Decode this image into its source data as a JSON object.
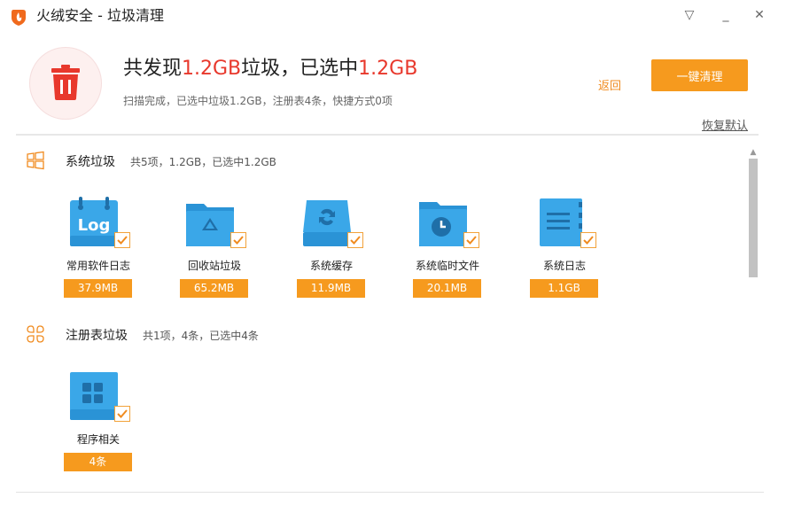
{
  "window": {
    "title": "火绒安全 - 垃圾清理",
    "controls": {
      "menu": "▽",
      "minimize": "_",
      "close": "✕"
    }
  },
  "summary": {
    "headline_pre": "共发现",
    "headline_size1": "1.2GB",
    "headline_mid": "垃圾，已选中",
    "headline_size2": "1.2GB",
    "subline": "扫描完成，已选中垃圾1.2GB，注册表4条，快捷方式0项",
    "back_label": "返回",
    "clean_button_label": "一键清理",
    "restore_label": "恢复默认"
  },
  "sections": [
    {
      "title": "系统垃圾",
      "meta": "共5项，1.2GB，已选中1.2GB",
      "icon": "windows-icon",
      "items": [
        {
          "label": "常用软件日志",
          "size": "37.9MB",
          "icon": "log-icon",
          "checked": true
        },
        {
          "label": "回收站垃圾",
          "size": "65.2MB",
          "icon": "recycle-folder-icon",
          "checked": true
        },
        {
          "label": "系统缓存",
          "size": "11.9MB",
          "icon": "cache-icon",
          "checked": true
        },
        {
          "label": "系统临时文件",
          "size": "20.1MB",
          "icon": "temp-folder-icon",
          "checked": true
        },
        {
          "label": "系统日志",
          "size": "1.1GB",
          "icon": "system-log-icon",
          "checked": true
        }
      ]
    },
    {
      "title": "注册表垃圾",
      "meta": "共1项，4条，已选中4条",
      "icon": "registry-icon",
      "items": [
        {
          "label": "程序相关",
          "size": "4条",
          "icon": "program-icon",
          "checked": true
        }
      ]
    }
  ],
  "colors": {
    "accent": "#f69a1e",
    "highlight": "#e8382c",
    "tile_blue": "#3aa7e8"
  }
}
